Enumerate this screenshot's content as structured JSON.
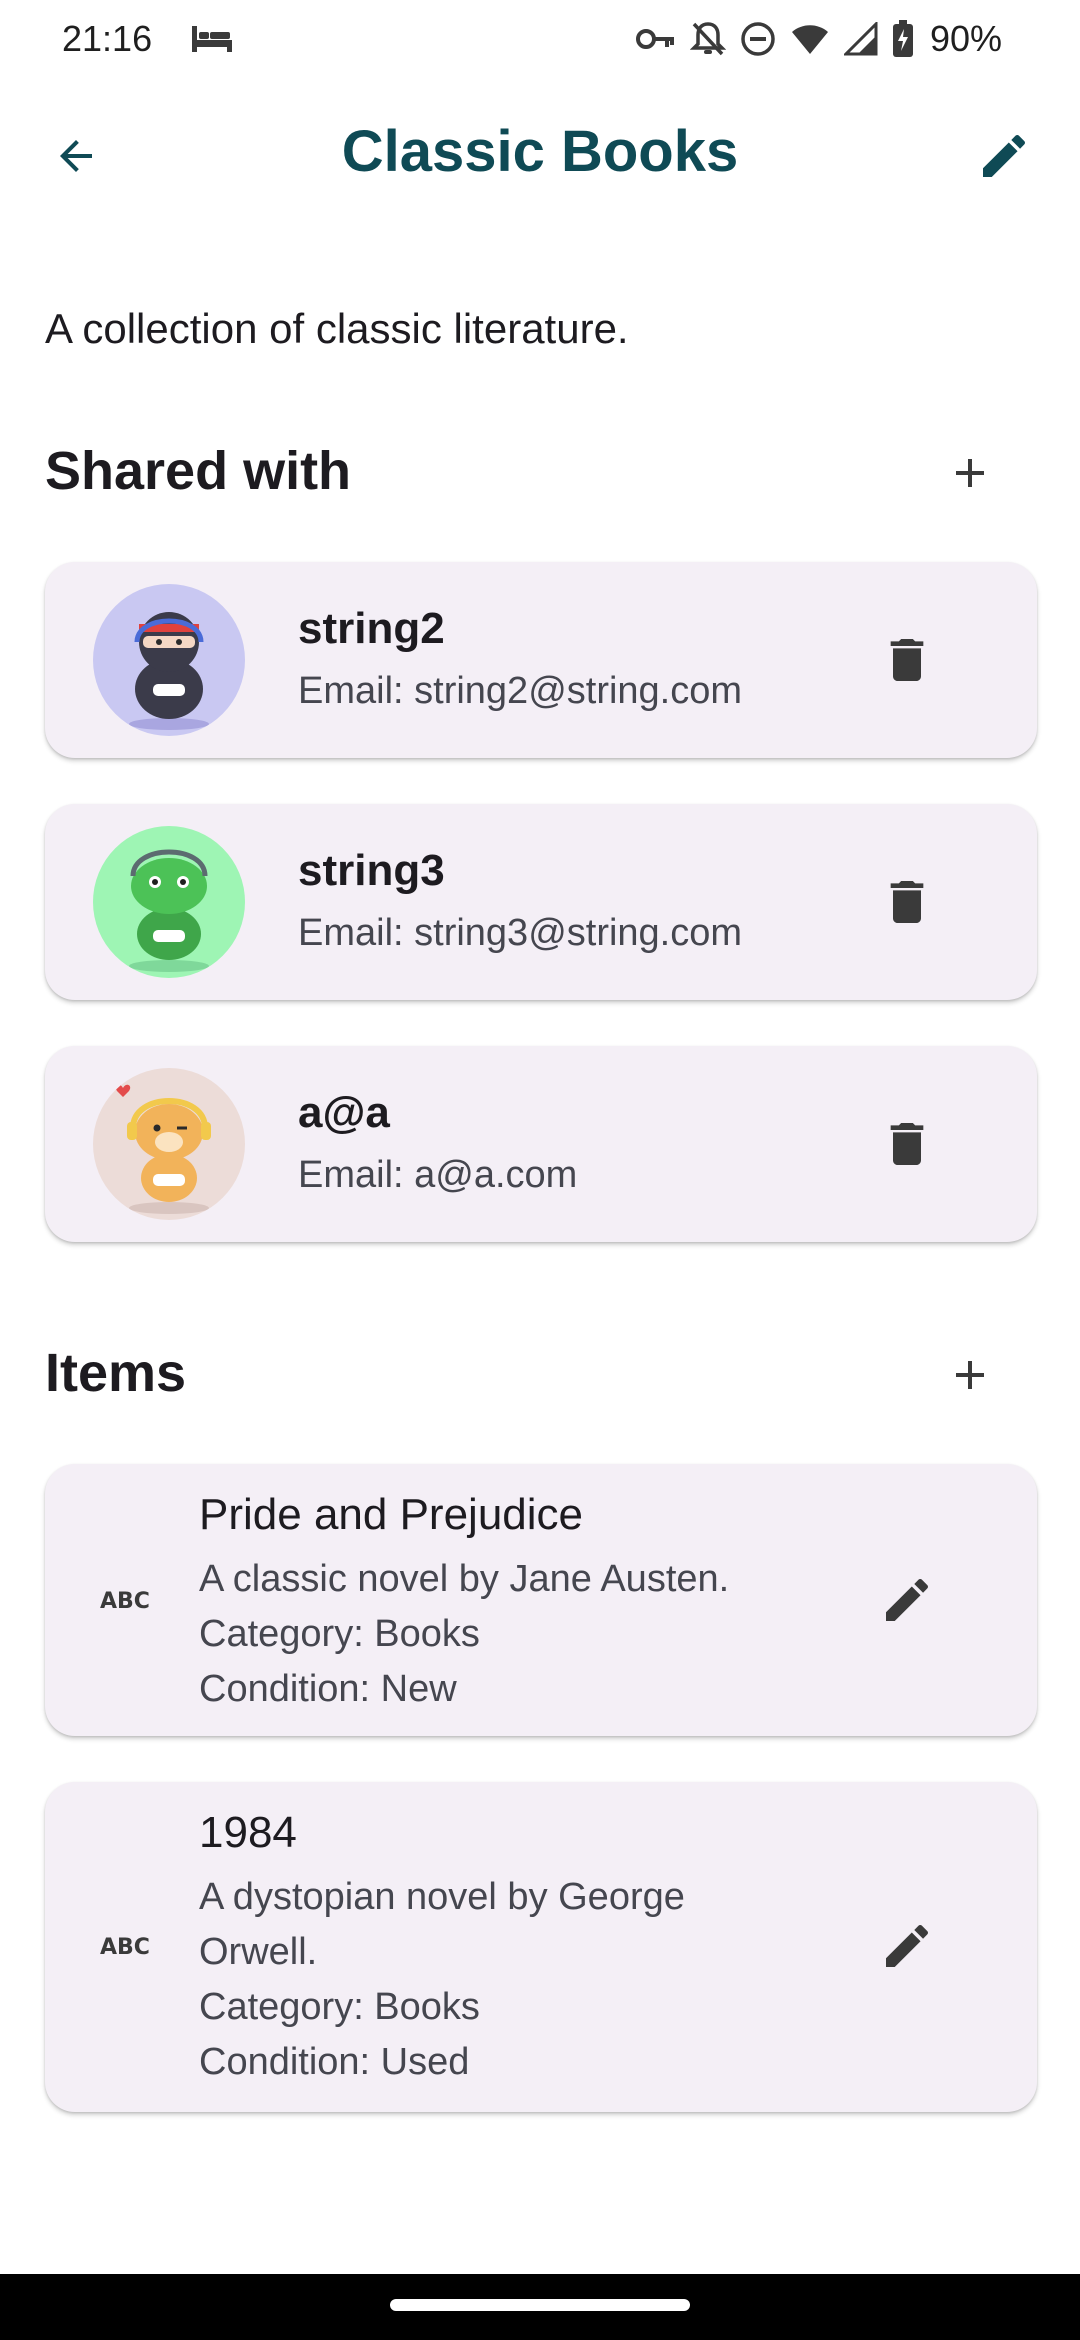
{
  "status_bar": {
    "time": "21:16",
    "battery": "90%",
    "icons": [
      "bed-icon",
      "key-icon",
      "bell-off-icon",
      "dnd-icon",
      "wifi-icon",
      "signal-icon",
      "battery-charging-icon"
    ]
  },
  "app_bar": {
    "title": "Classic Books",
    "back_icon": "arrow-left-icon",
    "edit_icon": "pencil-icon"
  },
  "description": "A collection of classic literature.",
  "shared": {
    "title": "Shared with",
    "users": [
      {
        "name": "string2",
        "email": "Email: string2@string.com",
        "avatar": "ninja-gamer-avatar"
      },
      {
        "name": "string3",
        "email": "Email: string3@string.com",
        "avatar": "dino-gamer-avatar"
      },
      {
        "name": "a@a",
        "email": "Email: a@a.com",
        "avatar": "dog-gamer-avatar"
      }
    ]
  },
  "items": {
    "title": "Items",
    "list": [
      {
        "title": "Pride and Prejudice",
        "description": "A classic novel by Jane Austen.",
        "category": "Category: Books",
        "condition": "Condition: New"
      },
      {
        "title": "1984",
        "description_line1": "A dystopian novel by George",
        "description_line2": "Orwell.",
        "category": "Category: Books",
        "condition": "Condition: Used"
      }
    ]
  },
  "colors": {
    "title": "#0f4a55",
    "card_bg": "#f4eff6",
    "text": "#1d1b20",
    "secondary_text": "#45464f"
  }
}
